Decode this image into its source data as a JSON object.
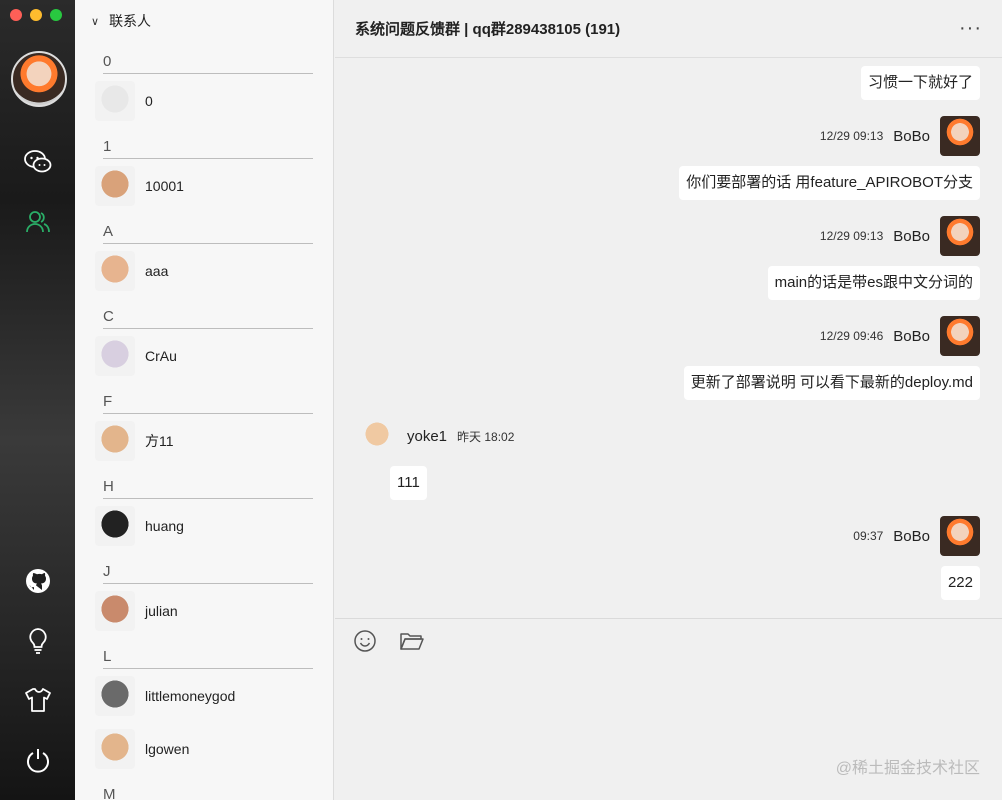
{
  "rail": {
    "icons": [
      "chat-icon",
      "contacts-icon",
      "github-icon",
      "lightbulb-icon",
      "shirt-icon",
      "power-icon"
    ]
  },
  "contacts": {
    "header": "联系人",
    "groups": [
      {
        "letter": "0",
        "items": [
          {
            "name": "0",
            "avatar": "#e8e8e8"
          }
        ]
      },
      {
        "letter": "1",
        "items": [
          {
            "name": "10001",
            "avatar": "#d9a27a"
          }
        ]
      },
      {
        "letter": "A",
        "items": [
          {
            "name": "aaa",
            "avatar": "#e7b48f"
          }
        ]
      },
      {
        "letter": "C",
        "items": [
          {
            "name": "CrAu",
            "avatar": "#d8cfe0"
          }
        ]
      },
      {
        "letter": "F",
        "items": [
          {
            "name": "方11",
            "avatar": "#e3b58c"
          }
        ]
      },
      {
        "letter": "H",
        "items": [
          {
            "name": "huang",
            "avatar": "#222222"
          }
        ]
      },
      {
        "letter": "J",
        "items": [
          {
            "name": "julian",
            "avatar": "#c98a6c"
          }
        ]
      },
      {
        "letter": "L",
        "items": [
          {
            "name": "littlemoneygod",
            "avatar": "#6a6a6a"
          },
          {
            "name": "lgowen",
            "avatar": "#e3b58c"
          }
        ]
      },
      {
        "letter": "M",
        "items": []
      }
    ]
  },
  "chat": {
    "title": "系统问题反馈群 | qq群289438105 (191)",
    "more": "···",
    "messages": [
      {
        "text": "习惯一下就好了"
      },
      {
        "time": "12/29 09:13",
        "name": "BoBo",
        "text": "你们要部署的话 用feature_APIROBOT分支"
      },
      {
        "time": "12/29 09:13",
        "name": "BoBo",
        "text": "main的话是带es跟中文分词的"
      },
      {
        "time": "12/29 09:46",
        "name": "BoBo",
        "text": "更新了部署说明 可以看下最新的deploy.md"
      },
      {
        "time": "昨天 18:02",
        "name": "yoke1",
        "text": "111"
      },
      {
        "time": "09:37",
        "name": "BoBo",
        "text": "222"
      }
    ],
    "watermark": "@稀土掘金技术社区"
  },
  "colors": {
    "accent": "#2aae67",
    "rail_bg": "#1f1f1f"
  }
}
